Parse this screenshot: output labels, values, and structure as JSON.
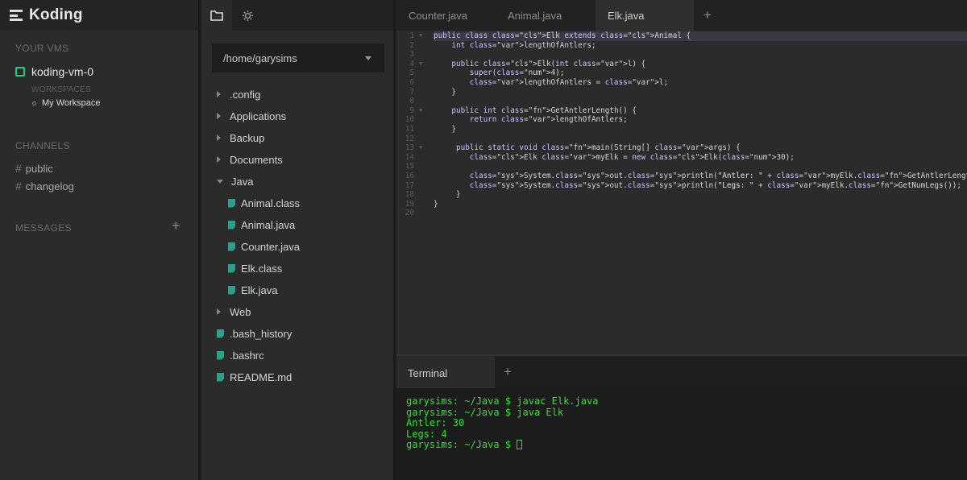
{
  "app": {
    "brand": "Koding"
  },
  "sidebar": {
    "your_vms_title": "YOUR VMS",
    "vm_name": "koding-vm-0",
    "workspaces_title": "WORKSPACES",
    "workspace_name": "My Workspace",
    "channels_title": "CHANNELS",
    "channels": [
      "public",
      "changelog"
    ],
    "messages_title": "MESSAGES",
    "add_message_label": "+"
  },
  "filetree": {
    "path": "/home/garysims",
    "items": [
      {
        "label": ".config",
        "kind": "folder"
      },
      {
        "label": "Applications",
        "kind": "folder"
      },
      {
        "label": "Backup",
        "kind": "folder"
      },
      {
        "label": "Documents",
        "kind": "folder"
      },
      {
        "label": "Java",
        "kind": "folder-open"
      },
      {
        "label": "Animal.class",
        "kind": "file"
      },
      {
        "label": "Animal.java",
        "kind": "file"
      },
      {
        "label": "Counter.java",
        "kind": "file"
      },
      {
        "label": "Elk.class",
        "kind": "file"
      },
      {
        "label": "Elk.java",
        "kind": "file"
      },
      {
        "label": "Web",
        "kind": "folder"
      },
      {
        "label": ".bash_history",
        "kind": "file"
      },
      {
        "label": ".bashrc",
        "kind": "file"
      },
      {
        "label": "README.md",
        "kind": "file"
      }
    ]
  },
  "editor": {
    "tabs": [
      "Counter.java",
      "Animal.java",
      "Elk.java"
    ],
    "active_tab": "Elk.java",
    "add_tab_label": "+",
    "line_numbers": [
      "1",
      "2",
      "3",
      "4",
      "5",
      "6",
      "7",
      "8",
      "9",
      "10",
      "11",
      "12",
      "13",
      "14",
      "15",
      "16",
      "17",
      "18",
      "19",
      "20"
    ],
    "code_lines": [
      "public class Elk extends Animal {",
      "    int lengthOfAntlers;",
      "",
      "    public Elk(int l) {",
      "        super(4);",
      "        lengthOfAntlers = l;",
      "    }",
      "",
      "    public int GetAntlerLength() {",
      "        return lengthOfAntlers;",
      "    }",
      "",
      "     public static void main(String[] args) {",
      "        Elk myElk = new Elk(30);",
      "",
      "        System.out.println(\"Antler: \" + myElk.GetAntlerLength());",
      "        System.out.println(\"Legs: \" + myElk.GetNumLegs());",
      "     }",
      "}",
      ""
    ]
  },
  "terminal": {
    "tab_label": "Terminal",
    "add_tab_label": "+",
    "lines": [
      "garysims: ~/Java $ javac Elk.java",
      "garysims: ~/Java $ java Elk",
      "Antler: 30",
      "Legs: 4",
      "garysims: ~/Java $ "
    ]
  },
  "colors": {
    "accent_green": "#1fcf7c",
    "file_icon": "#22a58a",
    "terminal_text": "#33e033"
  }
}
